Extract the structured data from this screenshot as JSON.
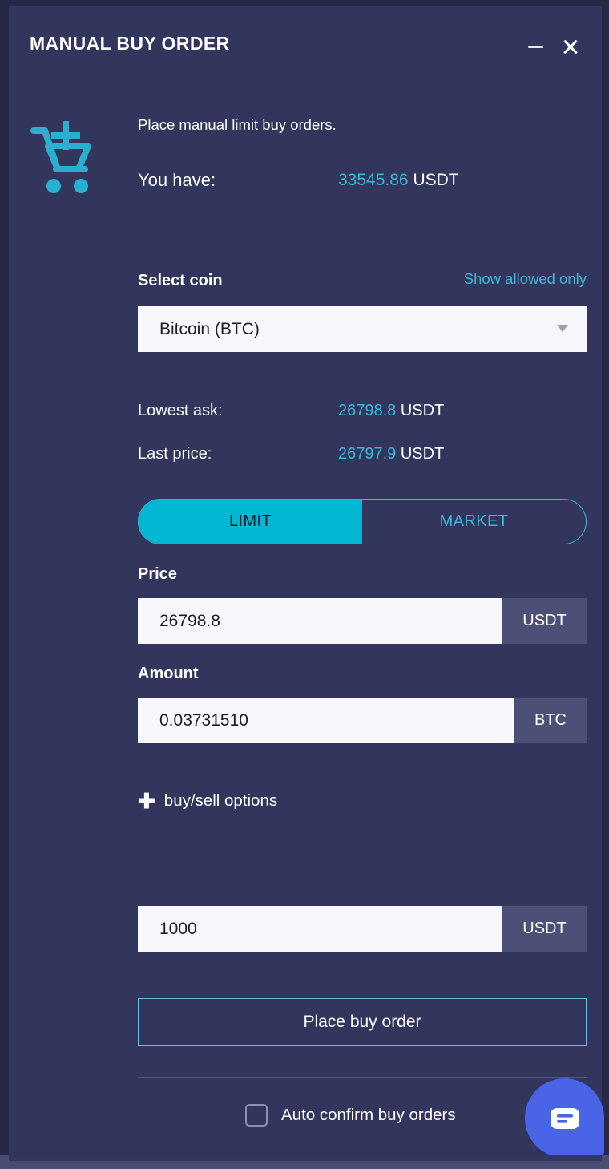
{
  "window": {
    "title": "MANUAL BUY ORDER",
    "minimize_label": "−",
    "close_label": "×"
  },
  "intro": {
    "description": "Place manual limit buy orders.",
    "balance_label": "You have:",
    "balance_value": "33545.86",
    "balance_currency": "USDT"
  },
  "coin": {
    "section_label": "Select coin",
    "show_allowed_label": "Show allowed only",
    "selected": "Bitcoin (BTC)"
  },
  "prices": {
    "lowest_ask_label": "Lowest ask:",
    "lowest_ask_value": "26798.8",
    "lowest_ask_currency": "USDT",
    "last_price_label": "Last price:",
    "last_price_value": "26797.9",
    "last_price_currency": "USDT"
  },
  "order_type": {
    "limit_label": "LIMIT",
    "market_label": "MARKET",
    "selected": "LIMIT"
  },
  "fields": {
    "price_label": "Price",
    "price_value": "26798.8",
    "price_unit": "USDT",
    "amount_label": "Amount",
    "amount_value": "0.03731510",
    "amount_unit": "BTC",
    "total_value": "1000",
    "total_unit": "USDT"
  },
  "options": {
    "plus_glyph": "✚",
    "buy_sell_options_label": "buy/sell options"
  },
  "actions": {
    "place_order_label": "Place buy order",
    "auto_confirm_label": "Auto confirm buy orders",
    "auto_confirm_checked": false
  },
  "icons": {
    "cart": "add-to-cart-icon",
    "chat": "chat-bubble-icon"
  },
  "colors": {
    "panel_bg": "#32355c",
    "accent_cyan": "#00b8d4",
    "link_cyan": "#3fb6d6",
    "input_bg": "#f8f8fc",
    "unit_bg": "#4d5076",
    "chat_blue": "#4a64e8",
    "divider": "#565a85"
  }
}
